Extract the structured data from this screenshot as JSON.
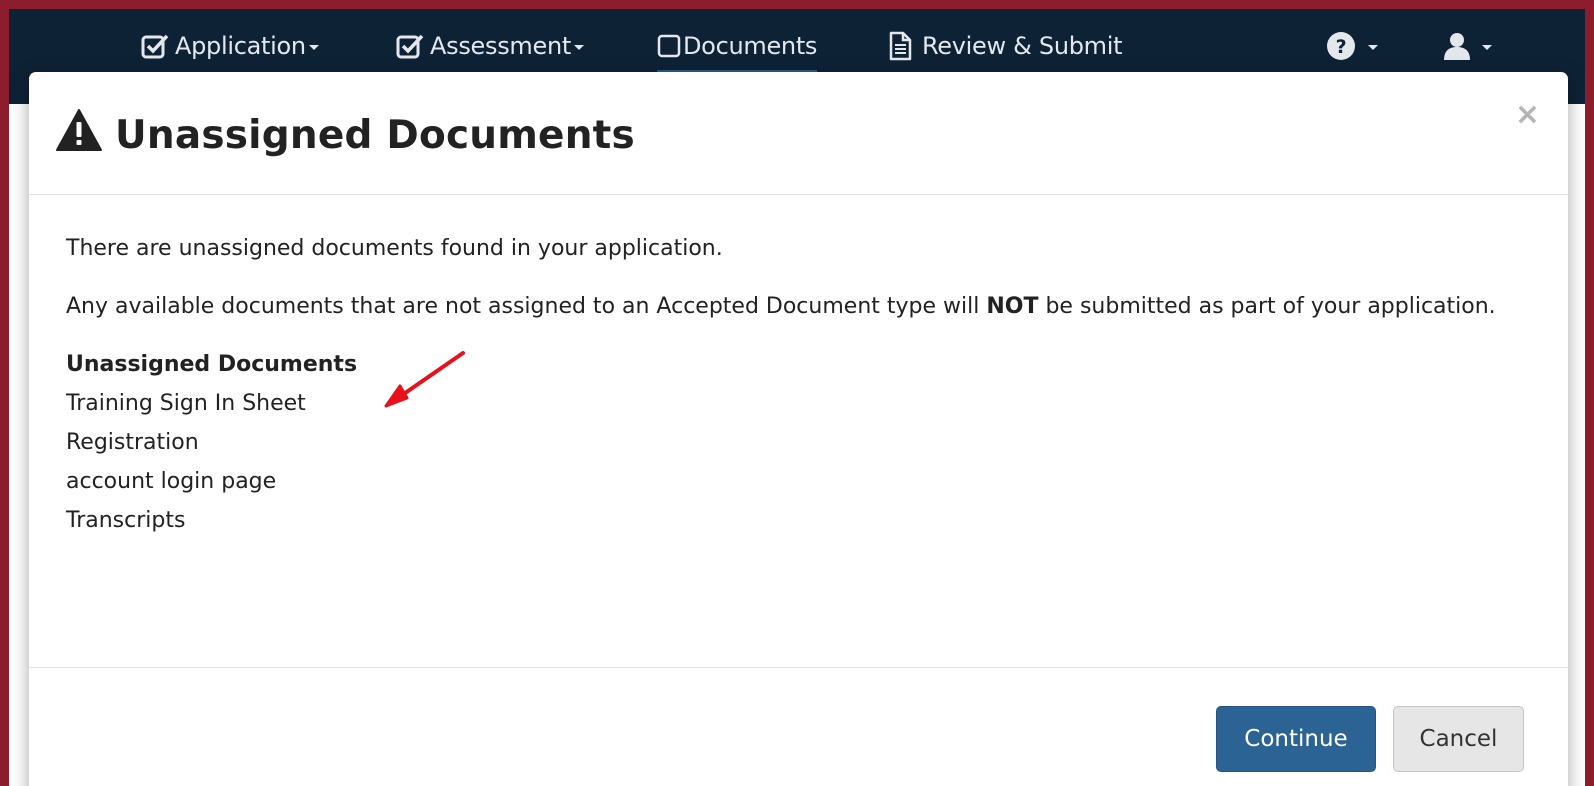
{
  "nav": {
    "items": [
      {
        "label": "Application",
        "icon": "check-square-icon",
        "has_caret": true
      },
      {
        "label": "Assessment",
        "icon": "check-square-icon",
        "has_caret": true
      },
      {
        "label": "Documents",
        "icon": "square-icon",
        "has_caret": false,
        "active": true
      },
      {
        "label": "Review & Submit",
        "icon": "file-text-icon",
        "has_caret": false
      }
    ],
    "help_icon": "question-circle-icon",
    "user_icon": "user-icon"
  },
  "modal": {
    "title": "Unassigned Documents",
    "title_icon": "warning-icon",
    "close_label": "×",
    "intro": "There are unassigned documents found in your application.",
    "warning_prefix": "Any available documents that are not assigned to an Accepted Document type will ",
    "warning_emphasis": "NOT",
    "warning_suffix": " be submitted as part of your application.",
    "list_title": "Unassigned Documents",
    "documents": [
      "Training Sign In Sheet",
      "Registration",
      "account login page",
      "Transcripts"
    ],
    "continue_label": "Continue",
    "cancel_label": "Cancel"
  },
  "colors": {
    "frame_border": "#8b1d2c",
    "navbar_bg": "#0e2236",
    "primary_button": "#2b6494",
    "annotation_arrow": "#e8111b"
  }
}
